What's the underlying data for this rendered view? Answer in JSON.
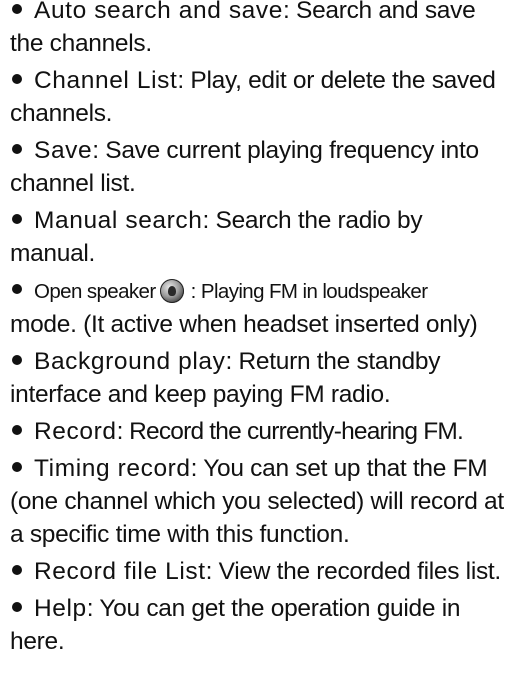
{
  "items": [
    {
      "term": "Auto search and save",
      "sep": ":",
      "desc": " Search and save the channels."
    },
    {
      "term": "Channel List",
      "sep": ":",
      "desc": " Play, edit or delete the saved channels."
    },
    {
      "term": "Save",
      "sep": ":",
      "desc": " Save current playing frequency into channel list."
    },
    {
      "term": "Manual search",
      "sep": ":",
      "desc": " Search the radio by manual."
    },
    {
      "term": "Open speaker",
      "desc_after_icon": " : Playing FM in loudspeaker",
      "desc_line2": "mode. (It active when headset inserted only)",
      "icon": "speaker-icon"
    },
    {
      "term": "Background play",
      "sep": ":",
      "desc": " Return the standby interface and keep paying FM radio."
    },
    {
      "term": "Record",
      "sep": ":",
      "desc": " Record the currently-hearing FM."
    },
    {
      "term": "Timing record",
      "sep": ":",
      "desc": " You can set up that the FM (one channel which you selected) will record at a specific time with this function."
    },
    {
      "term": "Record file List",
      "sep": ":",
      "desc": " View the recorded files list."
    },
    {
      "term": "Help",
      "sep": ":",
      "desc": " You can get the operation guide in here."
    }
  ]
}
